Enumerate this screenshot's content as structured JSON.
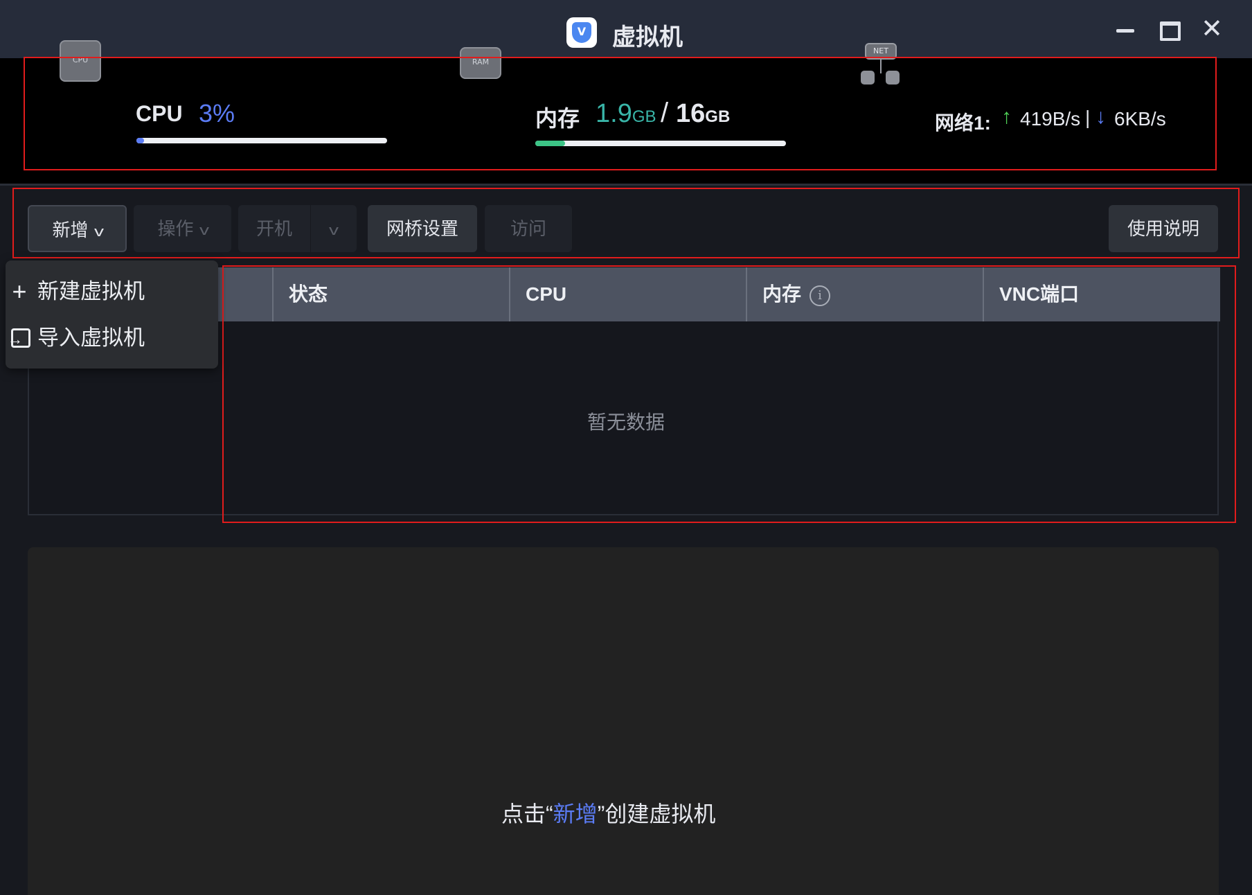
{
  "window": {
    "title": "虚拟机",
    "logo_letter": "V",
    "close_glyph": "✕"
  },
  "resources": {
    "cpu": {
      "label": "CPU",
      "value": "3%",
      "usage_fraction": 0.03,
      "chip_text": "CPU",
      "bar_color": "#5b7cf5"
    },
    "memory": {
      "label": "内存",
      "used": "1.9",
      "used_unit": "GB",
      "separator": "/",
      "total": "16",
      "total_unit": "GB",
      "usage_fraction": 0.12,
      "chip_text": "RAM",
      "bar_color": "#3cc486"
    },
    "network": {
      "label": "网络1:",
      "chip_text": "NET",
      "up_arrow": "↑",
      "up": "419B/s",
      "separator": "|",
      "down_arrow": "↓",
      "down": "6KB/s"
    }
  },
  "toolbar": {
    "new_label": "新增",
    "operate_label": "操作",
    "boot_label": "开机",
    "bridge_label": "网桥设置",
    "visit_label": "访问",
    "help_label": "使用说明",
    "chevron": "v"
  },
  "dropdown": {
    "items": [
      {
        "label": "新建虚拟机",
        "icon": "plus-icon",
        "glyph": "+"
      },
      {
        "label": "导入虚拟机",
        "icon": "import-icon"
      }
    ]
  },
  "table": {
    "columns": [
      "",
      "状态",
      "CPU",
      "内存",
      "VNC端口"
    ],
    "info_glyph": "i",
    "empty_text": "暂无数据"
  },
  "bottom": {
    "hint_prefix": "点击“",
    "hint_highlight": "新增",
    "hint_suffix": "”创建虚拟机"
  },
  "colors": {
    "accent": "#5b7cf5",
    "memory_value": "#39b5a8",
    "upload": "#4fd157",
    "annotation_frame": "#e11c1c"
  }
}
